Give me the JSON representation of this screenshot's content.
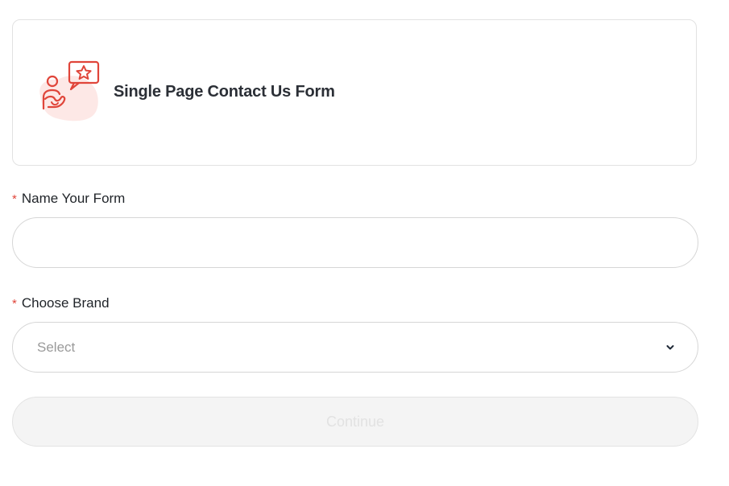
{
  "template_card": {
    "title": "Single Page Contact Us Form",
    "icon": "feedback-review-icon",
    "accent_color": "#e0453a"
  },
  "name_field": {
    "label": "Name Your Form",
    "required_mark": "*",
    "value": "",
    "placeholder": ""
  },
  "brand_field": {
    "label": "Choose Brand",
    "required_mark": "*",
    "selected": "Select",
    "icon": "chevron-down-icon"
  },
  "actions": {
    "continue_label": "Continue",
    "continue_disabled": true
  }
}
